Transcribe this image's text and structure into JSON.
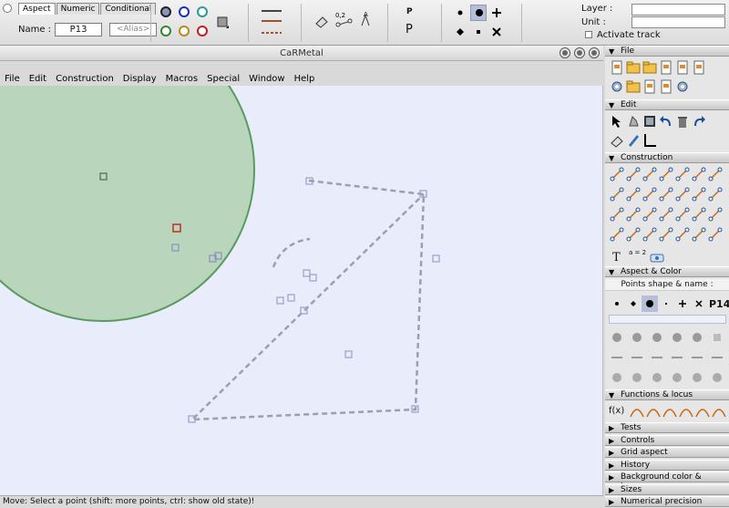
{
  "inspector": {
    "tabs": [
      "Aspect",
      "Numeric",
      "Conditional"
    ],
    "name_label": "Name :",
    "name_value": "P13",
    "alias_placeholder": "<Alias>",
    "layer_label": "Layer :",
    "unit_label": "Unit :",
    "activate_track_label": "Activate track",
    "decimals_label": "0,2",
    "point_label_p": "P"
  },
  "window": {
    "title": "CaRMetal"
  },
  "menu": [
    "File",
    "Edit",
    "Construction",
    "Display",
    "Macros",
    "Special",
    "Window",
    "Help"
  ],
  "status": "Move: Select a point (shift: more points, ctrl: show old state)!",
  "palette": {
    "sections": {
      "file": "File",
      "edit": "Edit",
      "construction": "Construction",
      "aspect_color": "Aspect & Color",
      "functions_locus": "Functions & locus",
      "tests": "Tests",
      "controls": "Controls",
      "grid_aspect": "Grid aspect",
      "history": "History",
      "background": "Background color & image",
      "sizes": "Sizes",
      "numerical_precision": "Numerical precision"
    },
    "points_shape_name": "Points shape & name :",
    "point_name_sample": "P14",
    "text_tool": "T",
    "fx_tool": "f(x)",
    "equation_tool": "a = 2",
    "decimals_tool": "0,2",
    "p_label_tool": "P"
  },
  "colors": {
    "canvas_bg": "#e9edfb",
    "circle_fill": "#b9d6bd",
    "circle_stroke": "#5a9a5f",
    "dashed": "#9aa0b3",
    "selected_point": "#c0392b"
  }
}
